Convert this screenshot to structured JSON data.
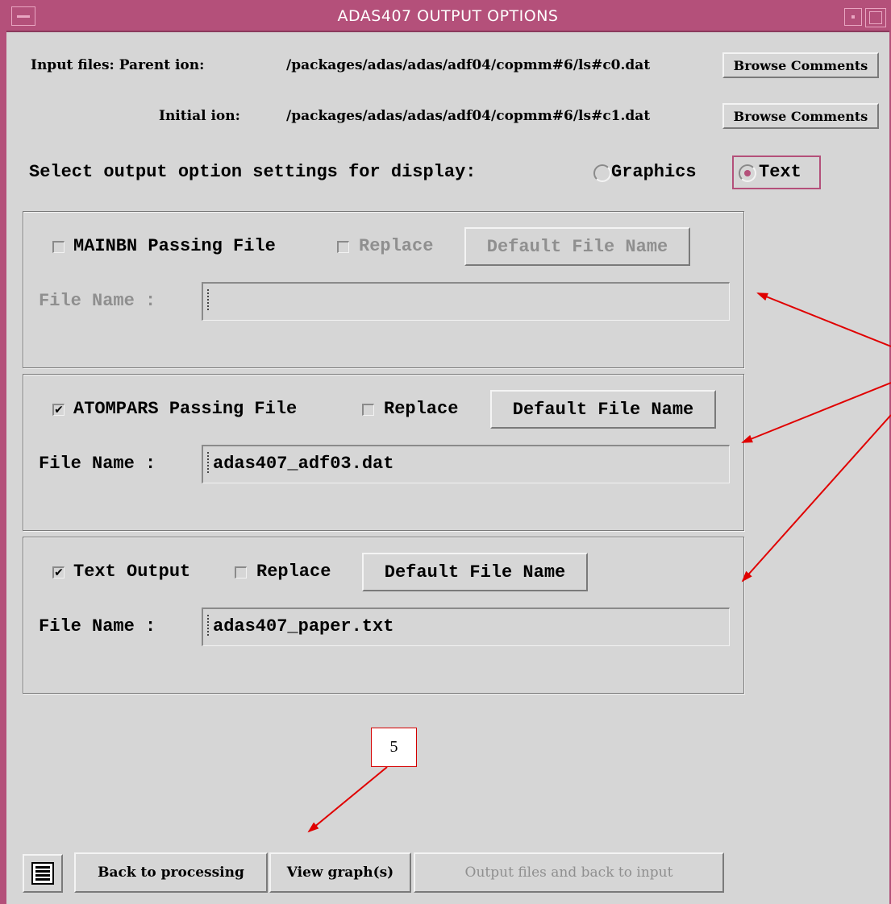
{
  "window": {
    "title": "ADAS407 OUTPUT OPTIONS"
  },
  "input_files": {
    "parent_label": "Input files: Parent ion:",
    "parent_path": "/packages/adas/adas/adf04/copmm#6/ls#c0.dat",
    "initial_label": "Initial ion:",
    "initial_path": "/packages/adas/adas/adf04/copmm#6/ls#c1.dat",
    "browse_label": "Browse Comments"
  },
  "display_select": {
    "label": "Select output option settings for display:",
    "options": [
      {
        "label": "Graphics",
        "selected": false
      },
      {
        "label": "Text",
        "selected": true
      }
    ]
  },
  "sections": {
    "mainbn": {
      "title": "MAINBN Passing File",
      "checked": false,
      "enabled": false,
      "replace_label": "Replace",
      "replace_checked": false,
      "default_label": "Default File Name",
      "file_label": "File Name :",
      "file_value": ""
    },
    "atompars": {
      "title": "ATOMPARS Passing File",
      "checked": true,
      "enabled": true,
      "replace_label": "Replace",
      "replace_checked": false,
      "default_label": "Default File Name",
      "file_label": "File Name :",
      "file_value": "adas407_adf03.dat"
    },
    "textout": {
      "title": "Text Output",
      "checked": true,
      "enabled": true,
      "replace_label": "Replace",
      "replace_checked": false,
      "default_label": "Default File Name",
      "file_label": "File Name :",
      "file_value": "adas407_paper.txt"
    }
  },
  "bottom": {
    "back_label": "Back to processing",
    "view_label": "View graph(s)",
    "output_label": "Output files and back to input"
  },
  "annotation": {
    "callout_label": "5",
    "arrow_color": "#e00000"
  },
  "colors": {
    "accent": "#b4507a",
    "background": "#d6d6d6"
  }
}
